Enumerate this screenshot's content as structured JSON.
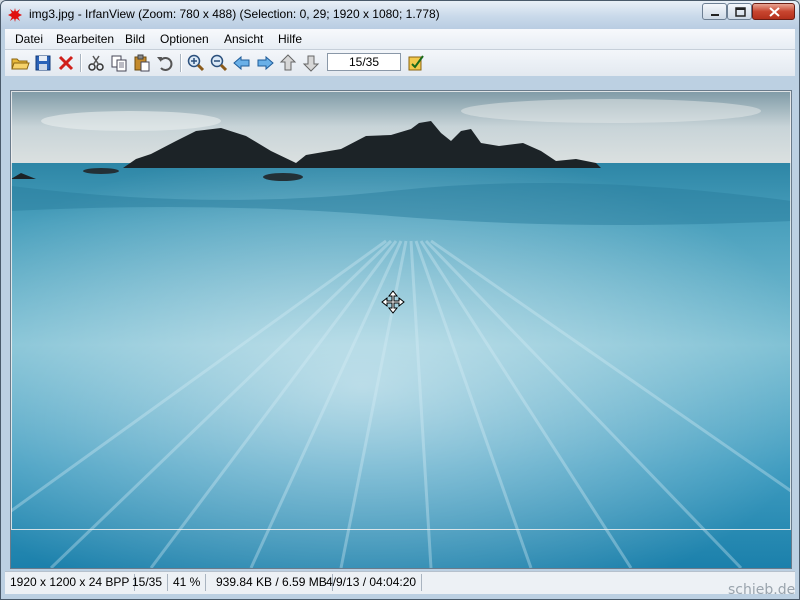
{
  "window": {
    "title": "img3.jpg - IrfanView (Zoom: 780 x 488) (Selection: 0, 29; 1920 x 1080; 1.778)"
  },
  "menu": [
    "Datei",
    "Bearbeiten",
    "Bild",
    "Optionen",
    "Ansicht",
    "Hilfe"
  ],
  "toolbar": {
    "page_indicator": "15/35",
    "icons": [
      "open-folder-icon",
      "save-icon",
      "delete-icon",
      "cut-icon",
      "copy-icon",
      "paste-icon",
      "undo-icon",
      "zoom-in-icon",
      "zoom-out-icon",
      "previous-arrow-icon",
      "next-arrow-icon",
      "first-page-icon",
      "last-page-icon",
      "properties-icon"
    ]
  },
  "statusbar": {
    "dimensions": "1920 x 1200 x 24 BPP",
    "index": "15/35",
    "zoom": "41 %",
    "filesize": "939.84 KB / 6.59 MB",
    "datetime": "4/9/13 / 04:04:20"
  },
  "watermark": "schieb.de",
  "colors": {
    "sea_top": "#2f8fb0",
    "sea_bottom": "#1f84ad",
    "sky": "#c9d6dc"
  }
}
